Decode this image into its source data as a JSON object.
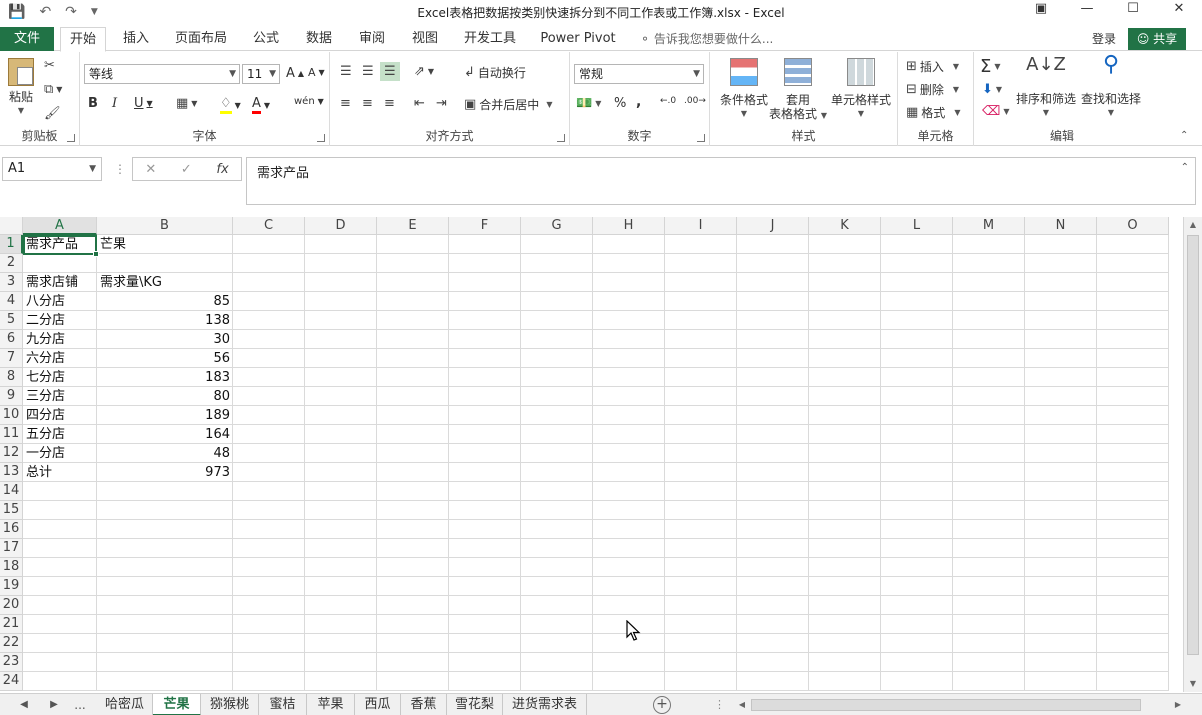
{
  "window": {
    "title": "Excel表格把数据按类别快速拆分到不同工作表或工作簿.xlsx - Excel"
  },
  "tabs": {
    "file": "文件",
    "items": [
      "开始",
      "插入",
      "页面布局",
      "公式",
      "数据",
      "审阅",
      "视图",
      "开发工具",
      "Power Pivot"
    ],
    "tell_me": "告诉我您想要做什么...",
    "login": "登录",
    "share": "共享"
  },
  "ribbon": {
    "clipboard": {
      "label": "剪贴板",
      "paste": "粘贴"
    },
    "font": {
      "label": "字体",
      "name": "等线",
      "size": "11"
    },
    "alignment": {
      "label": "对齐方式",
      "wrap": "自动换行",
      "merge": "合并后居中"
    },
    "number": {
      "label": "数字",
      "format": "常规"
    },
    "styles": {
      "label": "样式",
      "conditional": "条件格式",
      "table_l1": "套用",
      "table_l2": "表格格式",
      "cell_styles": "单元格样式"
    },
    "cells": {
      "label": "单元格",
      "insert": "插入",
      "delete": "删除",
      "format": "格式"
    },
    "editing": {
      "label": "编辑",
      "sort": "排序和筛选",
      "find": "查找和选择"
    }
  },
  "formula_bar": {
    "name_box": "A1",
    "content": "需求产品"
  },
  "grid": {
    "columns": [
      "A",
      "B",
      "C",
      "D",
      "E",
      "F",
      "G",
      "H",
      "I",
      "J",
      "K",
      "L",
      "M",
      "N",
      "O"
    ],
    "rows": [
      "1",
      "2",
      "3",
      "4",
      "5",
      "6",
      "7",
      "8",
      "9",
      "10",
      "11",
      "12",
      "13",
      "14",
      "15",
      "16",
      "17",
      "18",
      "19",
      "20",
      "21",
      "22",
      "23",
      "24"
    ],
    "cells": {
      "A1": "需求产品",
      "B1": "芒果",
      "A3": "需求店铺",
      "B3": "需求量\\KG",
      "A4": "八分店",
      "B4": "85",
      "A5": "二分店",
      "B5": "138",
      "A6": "九分店",
      "B6": "30",
      "A7": "六分店",
      "B7": "56",
      "A8": "七分店",
      "B8": "183",
      "A9": "三分店",
      "B9": "80",
      "A10": "四分店",
      "B10": "189",
      "A11": "五分店",
      "B11": "164",
      "A12": "一分店",
      "B12": "48",
      "A13": "总计",
      "B13": "973"
    }
  },
  "sheets": {
    "ellipsis": "...",
    "items": [
      "哈密瓜",
      "芒果",
      "猕猴桃",
      "蜜桔",
      "苹果",
      "西瓜",
      "香蕉",
      "雪花梨",
      "进货需求表"
    ],
    "active": "芒果"
  },
  "colors": {
    "accent": "#217346"
  }
}
